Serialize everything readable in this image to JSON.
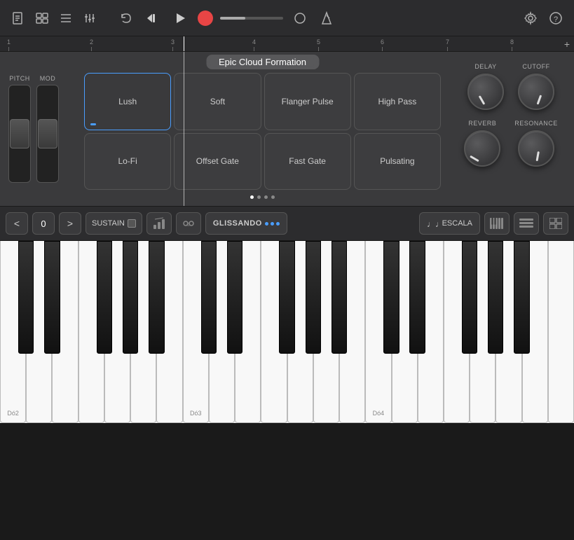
{
  "toolbar": {
    "icons": [
      "document",
      "windows",
      "list",
      "mixer",
      "undo",
      "rewind",
      "play",
      "record",
      "settings",
      "help"
    ]
  },
  "ruler": {
    "marks": [
      {
        "label": "1",
        "pos": 10
      },
      {
        "label": "2",
        "pos": 128
      },
      {
        "label": "3",
        "pos": 244
      },
      {
        "label": "4",
        "pos": 358
      },
      {
        "label": "5",
        "pos": 449
      },
      {
        "label": "6",
        "pos": 544
      },
      {
        "label": "7",
        "pos": 637
      },
      {
        "label": "8",
        "pos": 730
      }
    ]
  },
  "preset": {
    "name": "Epic Cloud Formation"
  },
  "pitch_label": "PITCH",
  "mod_label": "MOD",
  "knobs": {
    "delay_label": "DELAY",
    "cutoff_label": "CUTOFF",
    "reverb_label": "REVERB",
    "resonance_label": "RESONANCE"
  },
  "pads": {
    "row1": [
      {
        "id": "lush",
        "label": "Lush",
        "active": true
      },
      {
        "id": "soft",
        "label": "Soft",
        "active": false
      },
      {
        "id": "flanger_pulse",
        "label": "Flanger Pulse",
        "active": false
      },
      {
        "id": "high_pass",
        "label": "High Pass",
        "active": false
      }
    ],
    "row2": [
      {
        "id": "lo_fi",
        "label": "Lo-Fi",
        "active": false
      },
      {
        "id": "offset_gate",
        "label": "Offset Gate",
        "active": false
      },
      {
        "id": "fast_gate",
        "label": "Fast Gate",
        "active": false
      },
      {
        "id": "pulsating",
        "label": "Pulsating",
        "active": false
      }
    ],
    "dots": [
      {
        "active": true
      },
      {
        "active": false
      },
      {
        "active": false
      },
      {
        "active": false
      }
    ]
  },
  "bottom_bar": {
    "nav_prev": "<",
    "octave": "0",
    "nav_next": ">",
    "sustain_label": "SUSTAIN",
    "arpeggio_label": "arp",
    "chord_label": "chord",
    "glissando_label": "GLISSANDO",
    "glissando_dots": [
      {
        "color": "#4a9eff"
      },
      {
        "color": "#4a9eff"
      },
      {
        "color": "#4a9eff"
      }
    ],
    "escala_label": "ESCALA"
  },
  "keyboard": {
    "labels": [
      {
        "note": "Dó2",
        "pos_pct": 1
      },
      {
        "note": "Dó3",
        "pos_pct": 38
      },
      {
        "note": "Dó4",
        "pos_pct": 75
      }
    ]
  }
}
